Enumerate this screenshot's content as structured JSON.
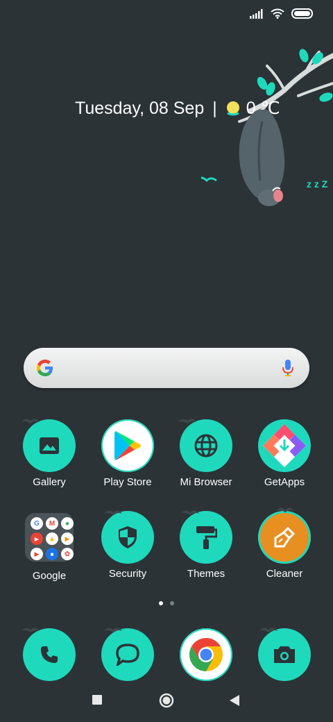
{
  "status_bar": {
    "icons": [
      "signal-icon",
      "wifi-icon",
      "battery-icon"
    ]
  },
  "date_widget": {
    "date": "Tuesday, 08 Sep",
    "separator": "|",
    "temperature": "0 ℃",
    "weather_icon": "sun-icon"
  },
  "search": {
    "logo": "google-logo-icon",
    "mic": "mic-icon"
  },
  "apps": [
    {
      "label": "Gallery",
      "icon": "gallery-icon"
    },
    {
      "label": "Play Store",
      "icon": "play-store-icon"
    },
    {
      "label": "Mi Browser",
      "icon": "globe-icon"
    },
    {
      "label": "GetApps",
      "icon": "getapps-icon"
    },
    {
      "label": "Google",
      "icon": "folder-icon"
    },
    {
      "label": "Security",
      "icon": "shield-icon"
    },
    {
      "label": "Themes",
      "icon": "paint-roller-icon"
    },
    {
      "label": "Cleaner",
      "icon": "broom-icon"
    }
  ],
  "folder_apps": [
    "G",
    "M",
    "Maps",
    "YouTube",
    "Drive",
    "Play Music",
    "Play Movies",
    "Duo",
    "Photos"
  ],
  "page_indicator": {
    "pages": 2,
    "current": 1
  },
  "dock": [
    {
      "icon": "phone-icon"
    },
    {
      "icon": "messaging-icon"
    },
    {
      "icon": "chrome-icon"
    },
    {
      "icon": "camera-icon"
    }
  ],
  "nav_bar": [
    "recents-button",
    "home-button",
    "back-button"
  ],
  "colors": {
    "background": "#2b3337",
    "accent_teal": "#1fd9bd",
    "cleaner_orange": "#e88f22"
  }
}
